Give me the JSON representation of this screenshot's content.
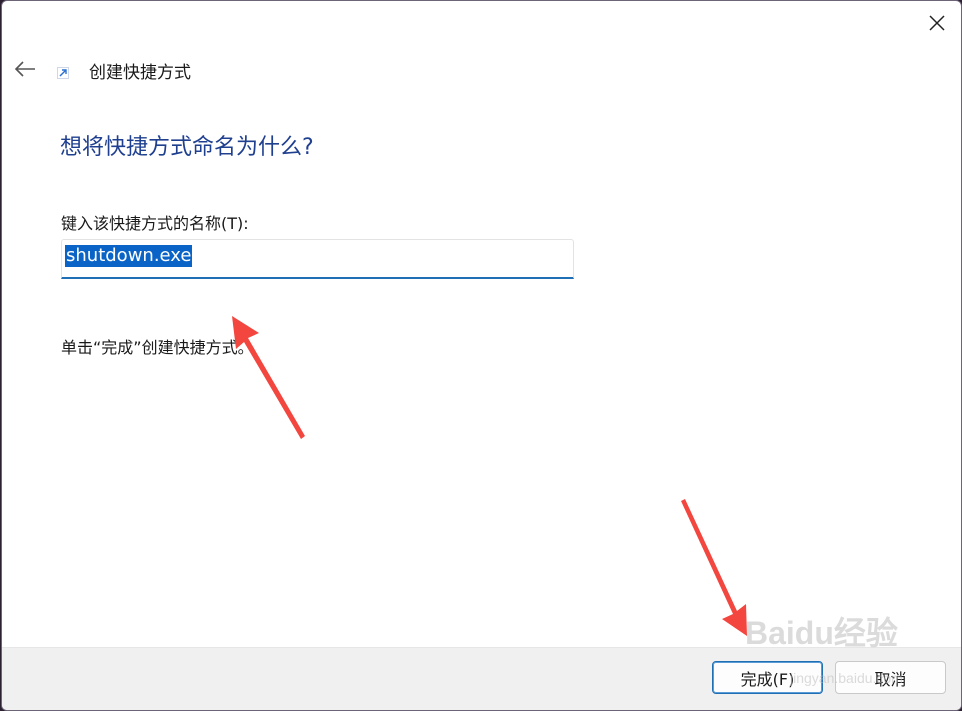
{
  "window": {
    "title": "创建快捷方式",
    "close_icon": "close-icon",
    "back_icon": "back-arrow-icon",
    "shortcut_icon": "shortcut-arrow-icon"
  },
  "main": {
    "heading": "想将快捷方式命名为什么?",
    "field_label": "键入该快捷方式的名称(T):",
    "name_value": "shutdown.exe",
    "hint": "单击“完成”创建快捷方式。"
  },
  "footer": {
    "finish_label": "完成(F)",
    "cancel_label": "取消"
  },
  "watermark": {
    "brand": "Baidu经验",
    "url": "jingyan.baidu.com"
  },
  "colors": {
    "heading": "#1f3f8f",
    "selection": "#0a64c8",
    "accent": "#1f6fb5",
    "annotation_arrow": "#f2463f"
  }
}
